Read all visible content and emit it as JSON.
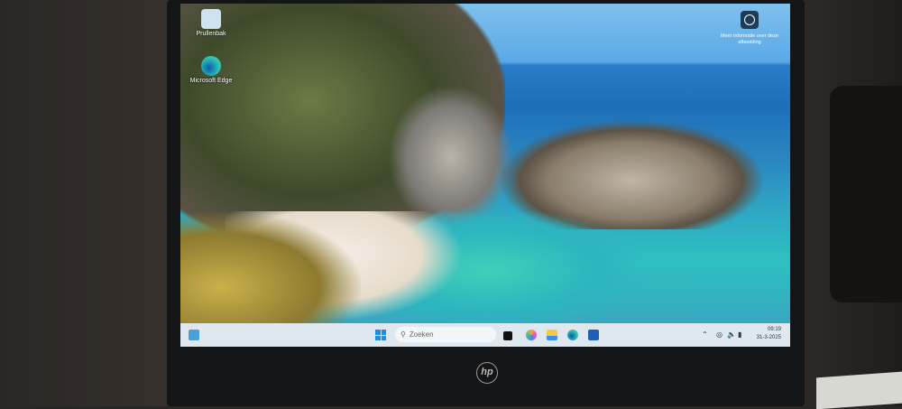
{
  "desktop": {
    "icons": [
      {
        "label": "Prullenbak",
        "icon": "recycle-bin-icon"
      },
      {
        "label": "Microsoft Edge",
        "icon": "edge-icon"
      }
    ],
    "spotlight_label": "Meer informatie over deze afbeelding"
  },
  "taskbar": {
    "search_placeholder": "Zoeken",
    "apps": [
      "task-view",
      "copilot",
      "file-explorer",
      "edge",
      "store"
    ],
    "time": "09:19",
    "date": "31-3-2025"
  },
  "brand": "hp"
}
